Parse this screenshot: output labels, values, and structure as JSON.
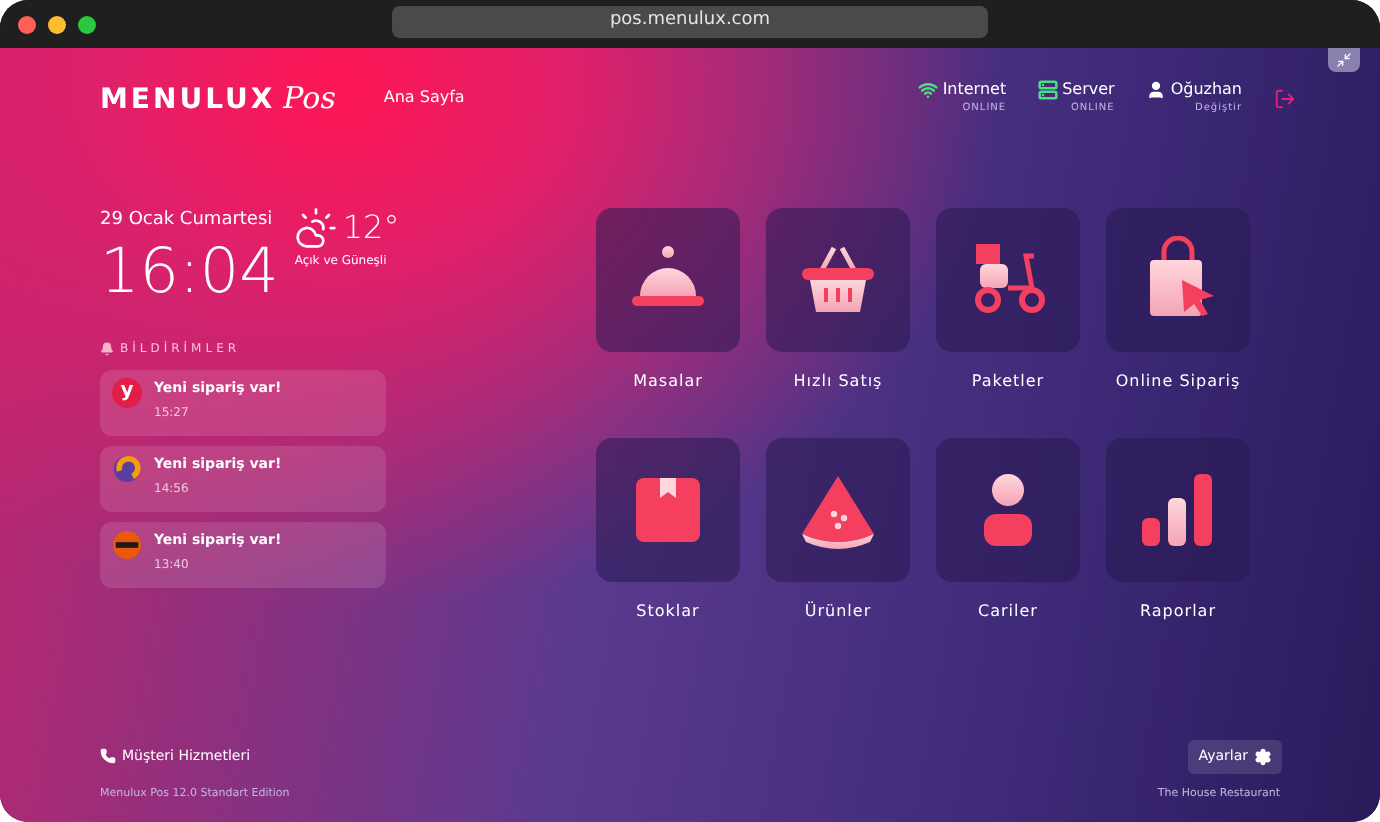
{
  "browser": {
    "url": "pos.menulux.com"
  },
  "header": {
    "logo": "MENULUX",
    "logo_suffix": "Pos",
    "nav": "Ana Sayfa",
    "status": [
      {
        "kind": "wifi",
        "label": "Internet",
        "sub": "ONLINE"
      },
      {
        "kind": "server",
        "label": "Server",
        "sub": "ONLINE"
      },
      {
        "kind": "user",
        "label": "Oğuzhan",
        "sub": "Değiştir"
      }
    ]
  },
  "clock": {
    "date": "29 Ocak Cumartesi",
    "time": "16:04",
    "temperature": "12°",
    "weather": "Açık ve Güneşli"
  },
  "notifications": {
    "title": "BİLDİRİMLER",
    "items": [
      {
        "kind": "letter",
        "badge": "y",
        "color": "#e11d48",
        "text": "Yeni sipariş var!",
        "time": "15:27"
      },
      {
        "kind": "swirl",
        "color": "#f59e0b",
        "text": "Yeni sipariş var!",
        "time": "14:56"
      },
      {
        "kind": "burger",
        "color": "#ea580c",
        "text": "Yeni sipariş var!",
        "time": "13:40"
      }
    ]
  },
  "tiles": [
    {
      "kind": "cloche",
      "label": "Masalar"
    },
    {
      "kind": "basket",
      "label": "Hızlı Satış"
    },
    {
      "kind": "scooter",
      "label": "Paketler"
    },
    {
      "kind": "bag",
      "label": "Online Sipariş"
    },
    {
      "kind": "box",
      "label": "Stoklar"
    },
    {
      "kind": "watermelon",
      "label": "Ürünler"
    },
    {
      "kind": "person",
      "label": "Cariler"
    },
    {
      "kind": "bars",
      "label": "Raporlar"
    }
  ],
  "footer": {
    "support": "Müşteri Hizmetleri",
    "settings": "Ayarlar",
    "edition": "Menulux Pos 12.0 Standart Edition",
    "restaurant": "The House Restaurant"
  }
}
